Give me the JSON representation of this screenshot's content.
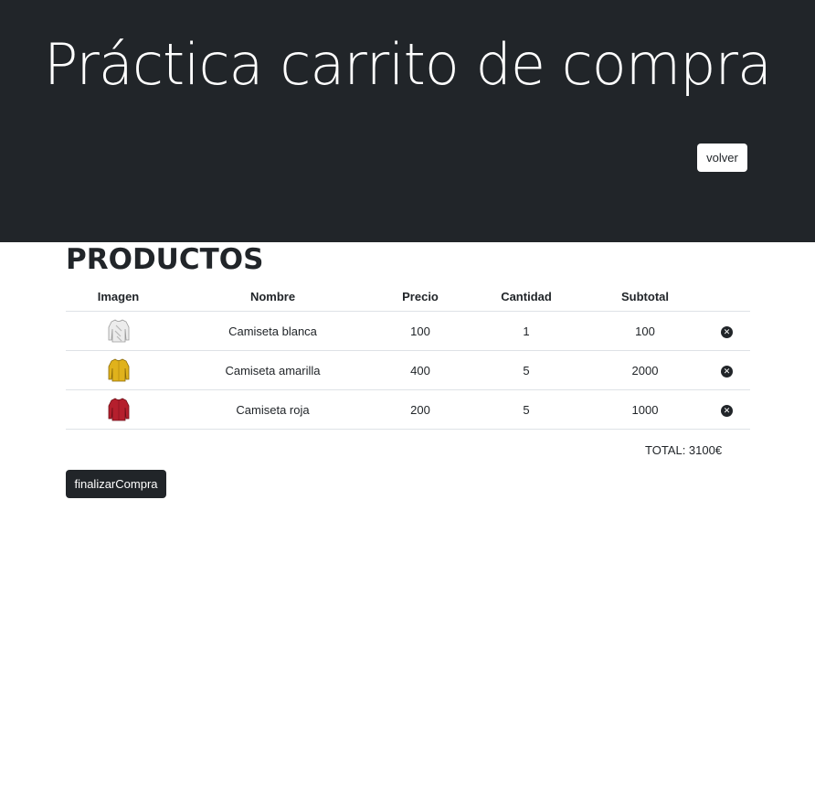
{
  "header": {
    "title": "Práctica carrito de compra",
    "back_label": "volver"
  },
  "products": {
    "heading": "PRODUCTOS",
    "columns": [
      "Imagen",
      "Nombre",
      "Precio",
      "Cantidad",
      "Subtotal",
      ""
    ],
    "rows": [
      {
        "image": "white-shirt",
        "color": "#e8e8e8",
        "name": "Camiseta blanca",
        "price": "100",
        "quantity": "1",
        "subtotal": "100"
      },
      {
        "image": "yellow-shirt",
        "color": "#e0b21c",
        "name": "Camiseta amarilla",
        "price": "400",
        "quantity": "5",
        "subtotal": "2000"
      },
      {
        "image": "red-shirt",
        "color": "#b51f2d",
        "name": "Camiseta roja",
        "price": "200",
        "quantity": "5",
        "subtotal": "1000"
      }
    ],
    "total_label": "TOTAL: 3100€"
  },
  "actions": {
    "finish_label": "finalizarCompra"
  },
  "colors": {
    "dark": "#212529",
    "border": "#dee2e6"
  }
}
